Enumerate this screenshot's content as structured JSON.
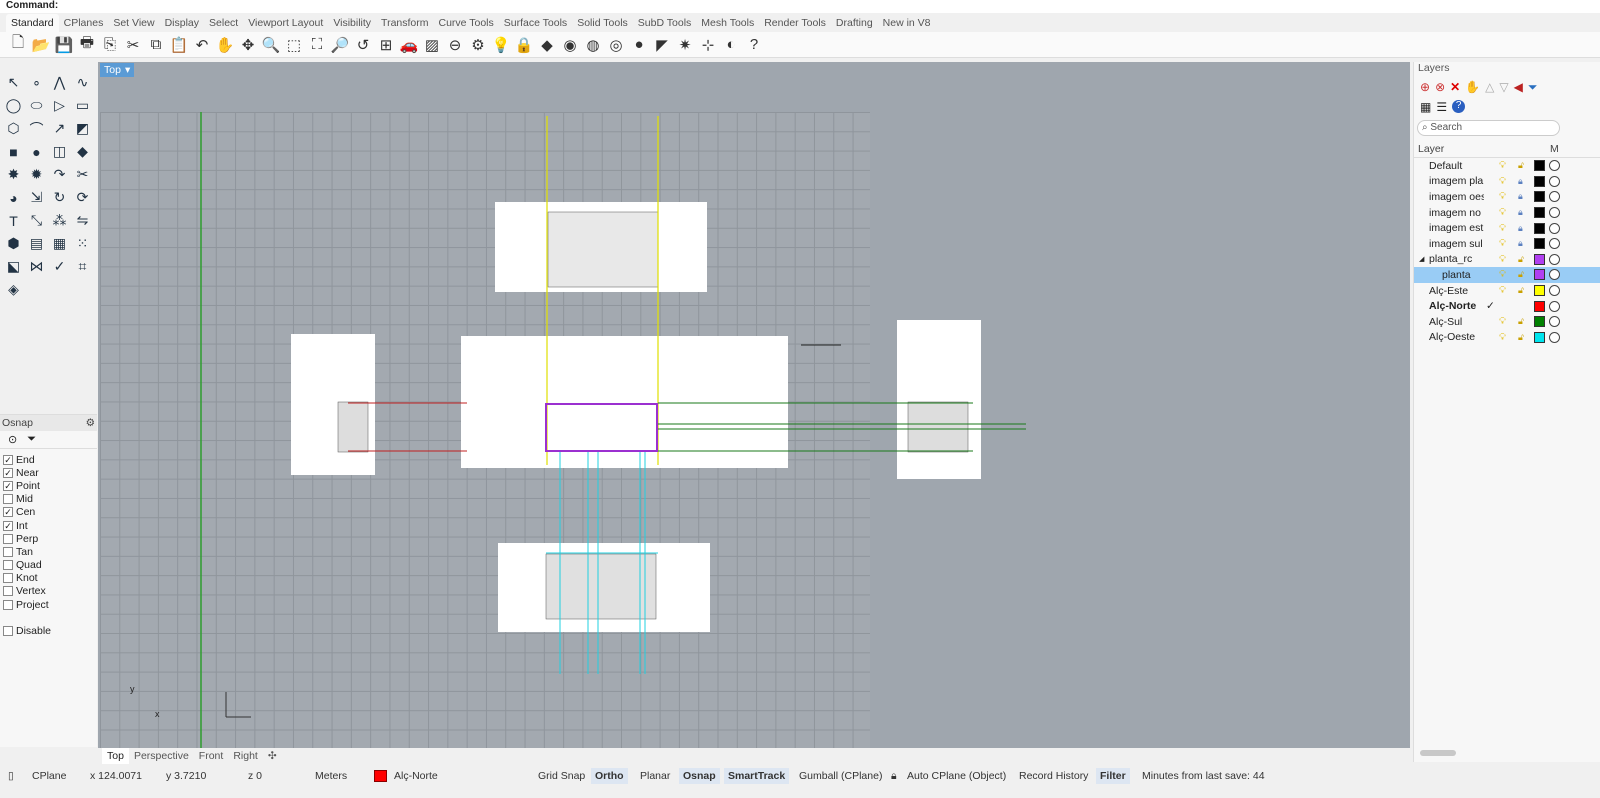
{
  "command": {
    "label": "Command:"
  },
  "tabs": [
    "Standard",
    "CPlanes",
    "Set View",
    "Display",
    "Select",
    "Viewport Layout",
    "Visibility",
    "Transform",
    "Curve Tools",
    "Surface Tools",
    "Solid Tools",
    "SubD Tools",
    "Mesh Tools",
    "Render Tools",
    "Drafting",
    "New in V8"
  ],
  "toolbar_icons": [
    [
      "new-file-icon",
      "🗋"
    ],
    [
      "open-icon",
      "📂"
    ],
    [
      "save-icon",
      "💾"
    ],
    [
      "print-icon",
      "🖶"
    ],
    [
      "import-icon",
      "⎘"
    ],
    [
      "cut-icon",
      "✂"
    ],
    [
      "copy-icon",
      "⧉"
    ],
    [
      "paste-icon",
      "📋"
    ],
    [
      "undo-icon",
      "↶"
    ],
    [
      "pan-icon",
      "✋"
    ],
    [
      "rotate-view-icon",
      "✥"
    ],
    [
      "zoom-icon",
      "🔍"
    ],
    [
      "zoom-window-icon",
      "⬚"
    ],
    [
      "zoom-extents-icon",
      "⛶"
    ],
    [
      "zoom-selected-icon",
      "🔎"
    ],
    [
      "undo-view-icon",
      "↺"
    ],
    [
      "four-viewports-icon",
      "⊞"
    ],
    [
      "car-icon",
      "🚗"
    ],
    [
      "layout-icon",
      "▨"
    ],
    [
      "cplane-icon",
      "⊖"
    ],
    [
      "object-props-icon",
      "⚙"
    ],
    [
      "light-icon",
      "💡"
    ],
    [
      "lock-icon",
      "🔒"
    ],
    [
      "shade-icon",
      "◆"
    ],
    [
      "color-wheel-icon",
      "◉"
    ],
    [
      "sphere-wire-icon",
      "◍"
    ],
    [
      "render-sphere-icon",
      "◎"
    ],
    [
      "blue-sphere-icon",
      "●"
    ],
    [
      "flag-icon",
      "◤"
    ],
    [
      "options-gear-icon",
      "✷"
    ],
    [
      "dimension-icon",
      "⊹"
    ],
    [
      "globe-icon",
      "◐"
    ],
    [
      "help-icon",
      "?"
    ]
  ],
  "left_tools": [
    [
      "select-icon",
      "↖"
    ],
    [
      "point-icon",
      "∘"
    ],
    [
      "polyline-icon",
      "⋀"
    ],
    [
      "curve-icon",
      "∿"
    ],
    [
      "circle-icon",
      "◯"
    ],
    [
      "ellipse-icon",
      "⬭"
    ],
    [
      "polygon-icon",
      "▷"
    ],
    [
      "rectangle-icon",
      "▭"
    ],
    [
      "fillet-icon",
      "⬡"
    ],
    [
      "arc-icon",
      "⌒"
    ],
    [
      "offset-icon",
      "↗"
    ],
    [
      "surface-icon",
      "◩"
    ],
    [
      "box-icon",
      "■"
    ],
    [
      "sphere-icon",
      "●"
    ],
    [
      "cylinder-icon",
      "◫"
    ],
    [
      "plane-icon",
      "◆"
    ],
    [
      "split-icon",
      "✸"
    ],
    [
      "explode-icon",
      "✹"
    ],
    [
      "blend-icon",
      "↷"
    ],
    [
      "trim-icon",
      "✂"
    ],
    [
      "boolean-icon",
      "◕"
    ],
    [
      "extrude-icon",
      "⇲"
    ],
    [
      "rotate-icon",
      "↻"
    ],
    [
      "sweep-icon",
      "⟳"
    ],
    [
      "text-icon",
      "T"
    ],
    [
      "scale-icon",
      "⤡"
    ],
    [
      "array-icon",
      "⁂"
    ],
    [
      "mirror-icon",
      "⇋"
    ],
    [
      "solid-icon",
      "⬢"
    ],
    [
      "hatch-icon",
      "▤"
    ],
    [
      "grid-array-icon",
      "▦"
    ],
    [
      "dots-icon",
      "⁙"
    ],
    [
      "transform-icon",
      "⬕"
    ],
    [
      "unroll-icon",
      "⋈"
    ],
    [
      "check-icon",
      "✓"
    ],
    [
      "analyze-icon",
      "⌗"
    ],
    [
      "layer-tool-icon",
      "◈"
    ]
  ],
  "osnap": {
    "title": "Osnap",
    "items": [
      {
        "label": "End",
        "checked": true
      },
      {
        "label": "Near",
        "checked": true
      },
      {
        "label": "Point",
        "checked": true
      },
      {
        "label": "Mid",
        "checked": false
      },
      {
        "label": "Cen",
        "checked": true
      },
      {
        "label": "Int",
        "checked": true
      },
      {
        "label": "Perp",
        "checked": false
      },
      {
        "label": "Tan",
        "checked": false
      },
      {
        "label": "Quad",
        "checked": false
      },
      {
        "label": "Knot",
        "checked": false
      },
      {
        "label": "Vertex",
        "checked": false
      },
      {
        "label": "Project",
        "checked": false
      }
    ],
    "disable": "Disable"
  },
  "viewport": {
    "title": "Top",
    "axis_x": "x",
    "axis_y": "y"
  },
  "viewport_tabs": [
    "Top",
    "Perspective",
    "Front",
    "Right"
  ],
  "layers": {
    "title": "Layers",
    "search_placeholder": "Search",
    "col_layer": "Layer",
    "col_m": "M",
    "rows": [
      {
        "name": "Default",
        "color": "#000000",
        "locked": false,
        "sel": false,
        "bold": false,
        "indent": 0
      },
      {
        "name": "imagem pla",
        "color": "#000000",
        "locked": true,
        "sel": false,
        "bold": false,
        "indent": 0
      },
      {
        "name": "imagem oes",
        "color": "#000000",
        "locked": true,
        "sel": false,
        "bold": false,
        "indent": 0
      },
      {
        "name": "imagem no",
        "color": "#000000",
        "locked": true,
        "sel": false,
        "bold": false,
        "indent": 0
      },
      {
        "name": "imagem est",
        "color": "#000000",
        "locked": true,
        "sel": false,
        "bold": false,
        "indent": 0
      },
      {
        "name": "imagem sul",
        "color": "#000000",
        "locked": true,
        "sel": false,
        "bold": false,
        "indent": 0
      },
      {
        "name": "planta_rc",
        "color": "#b040f0",
        "locked": false,
        "sel": false,
        "bold": false,
        "indent": 0,
        "expand": "◢"
      },
      {
        "name": "planta",
        "color": "#b040f0",
        "locked": false,
        "sel": true,
        "bold": false,
        "indent": 1
      },
      {
        "name": "Alç-Este",
        "color": "#ffff00",
        "locked": false,
        "sel": false,
        "bold": false,
        "indent": 0
      },
      {
        "name": "Alç-Norte",
        "color": "#ff0000",
        "locked": false,
        "sel": false,
        "bold": true,
        "indent": 0,
        "current": "✓"
      },
      {
        "name": "Alç-Sul",
        "color": "#008000",
        "locked": false,
        "sel": false,
        "bold": false,
        "indent": 0
      },
      {
        "name": "Alç-Oeste",
        "color": "#00e5ee",
        "locked": false,
        "sel": false,
        "bold": false,
        "indent": 0
      }
    ]
  },
  "status": {
    "cplane": "CPlane",
    "x": "x 124.0071",
    "y": "y 3.7210",
    "z": "z 0",
    "units": "Meters",
    "layer": "Alç-Norte",
    "layer_color": "#ff0000",
    "grid_snap": "Grid Snap",
    "ortho": "Ortho",
    "planar": "Planar",
    "osnap": "Osnap",
    "smarttrack": "SmartTrack",
    "gumball": "Gumball (CPlane)",
    "auto_cplane": "Auto CPlane (Object)",
    "record_history": "Record History",
    "filter": "Filter",
    "minutes": "Minutes from last save: 44"
  }
}
